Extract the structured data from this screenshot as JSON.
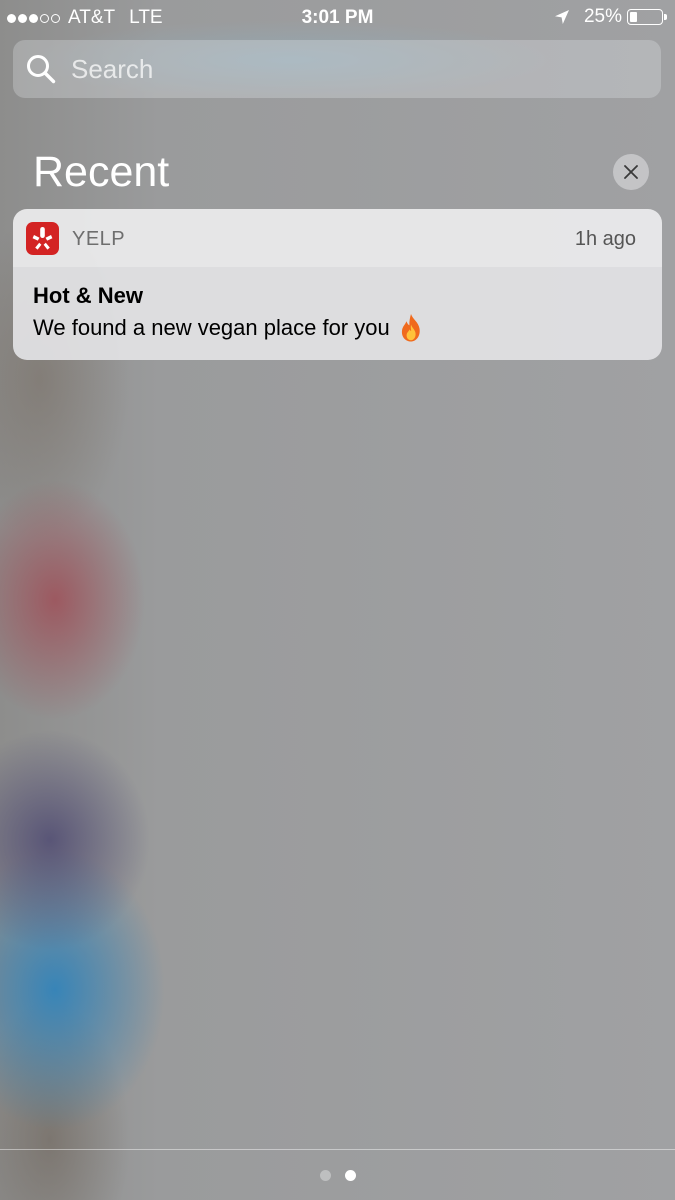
{
  "status_bar": {
    "signal_dots_filled": 3,
    "signal_dots_total": 5,
    "carrier": "AT&T",
    "network": "LTE",
    "time": "3:01 PM",
    "location_icon": "location-arrow-icon",
    "battery_percent_label": "25%",
    "battery_level": 0.25
  },
  "search": {
    "placeholder": "Search",
    "icon": "search-icon"
  },
  "recent": {
    "title": "Recent",
    "clear_icon": "close-icon"
  },
  "notifications": [
    {
      "app_name": "YELP",
      "app_icon": "yelp-logo-icon",
      "app_icon_color": "#d32323",
      "time": "1h ago",
      "title": "Hot & New",
      "message": "We found a new vegan place for you",
      "emoji_icon": "fire-emoji-icon"
    }
  ],
  "page_indicator": {
    "total": 2,
    "current": 2
  }
}
